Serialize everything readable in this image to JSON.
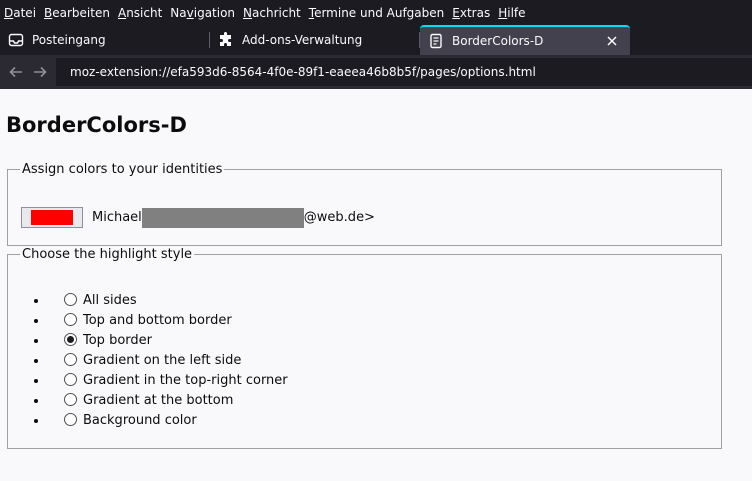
{
  "menubar": {
    "items": [
      {
        "accel": "D",
        "rest": "atei"
      },
      {
        "accel": "B",
        "rest": "earbeiten"
      },
      {
        "accel": "A",
        "rest": "nsicht"
      },
      {
        "pre": "Na",
        "accel": "v",
        "rest": "igation"
      },
      {
        "accel": "N",
        "rest": "achricht"
      },
      {
        "accel": "T",
        "rest": "ermine und Aufgaben"
      },
      {
        "accel": "E",
        "rest": "xtras"
      },
      {
        "accel": "H",
        "rest": "ilfe"
      }
    ]
  },
  "tabs": [
    {
      "label": "Posteingang",
      "icon": "inbox-icon"
    },
    {
      "label": "Add-ons-Verwaltung",
      "icon": "puzzle-icon"
    },
    {
      "label": "BorderColors-D",
      "icon": "document-icon",
      "active": true
    }
  ],
  "navbar": {
    "url": "moz-extension://efa593d6-8564-4f0e-89f1-eaeea46b8b5f/pages/options.html"
  },
  "page": {
    "title": "BorderColors-D",
    "identities_legend": "Assign colors to your identities",
    "identity": {
      "prefix": "Michael",
      "suffix": "@web.de>",
      "color": "#ff0000"
    },
    "style_legend": "Choose the highlight style",
    "styles": [
      {
        "label": "All sides",
        "checked": false
      },
      {
        "label": "Top and bottom border",
        "checked": false
      },
      {
        "label": "Top border",
        "checked": true
      },
      {
        "label": "Gradient on the left side",
        "checked": false
      },
      {
        "label": "Gradient in the top-right corner",
        "checked": false
      },
      {
        "label": "Gradient at the bottom",
        "checked": false
      },
      {
        "label": "Background color",
        "checked": false
      }
    ]
  },
  "colors": {
    "chrome_dark": "#1c1b22",
    "tab_active": "#42414d",
    "tab_accent": "#00ddff",
    "page_bg": "#f9f9fb"
  }
}
